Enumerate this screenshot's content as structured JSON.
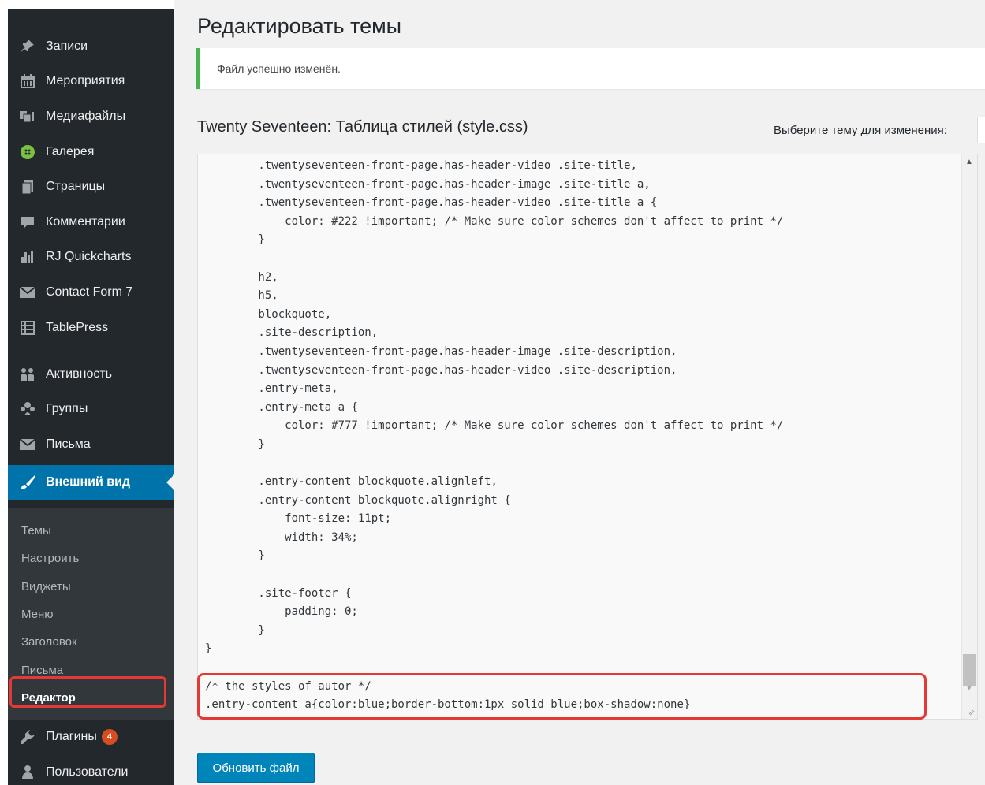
{
  "sidebar": {
    "items": [
      {
        "label": "Записи",
        "icon": "pin-icon"
      },
      {
        "label": "Мероприятия",
        "icon": "calendar-icon"
      },
      {
        "label": "Медиафайлы",
        "icon": "media-icon"
      },
      {
        "label": "Галерея",
        "icon": "gallery-icon"
      },
      {
        "label": "Страницы",
        "icon": "pages-icon"
      },
      {
        "label": "Комментарии",
        "icon": "comment-icon"
      },
      {
        "label": "RJ Quickcharts",
        "icon": "chart-icon"
      },
      {
        "label": "Contact Form 7",
        "icon": "mail-icon"
      },
      {
        "label": "TablePress",
        "icon": "table-icon"
      },
      {
        "label": "Активность",
        "icon": "activity-icon"
      },
      {
        "label": "Группы",
        "icon": "groups-icon"
      },
      {
        "label": "Письма",
        "icon": "envelope-icon"
      },
      {
        "label": "Внешний вид",
        "icon": "brush-icon"
      },
      {
        "label": "Плагины",
        "icon": "plugin-icon",
        "badge": "4"
      },
      {
        "label": "Пользователи",
        "icon": "user-icon"
      }
    ],
    "submenu": [
      "Темы",
      "Настроить",
      "Виджеты",
      "Меню",
      "Заголовок",
      "Письма",
      "Редактор"
    ]
  },
  "page": {
    "title": "Редактировать темы",
    "notice": "Файл успешно изменён.",
    "file_heading": "Twenty Seventeen: Таблица стилей (style.css)",
    "select_label": "Выберите тему для изменения:",
    "update_button": "Обновить файл"
  },
  "editor": {
    "lines": [
      "\t\t.twentyseventeen-front-page.has-header-video .site-title,",
      "\t\t.twentyseventeen-front-page.has-header-image .site-title a,",
      "\t\t.twentyseventeen-front-page.has-header-video .site-title a {",
      "\t\t\tcolor: #222 !important; /* Make sure color schemes don't affect to print */",
      "\t\t}",
      "",
      "\t\th2,",
      "\t\th5,",
      "\t\tblockquote,",
      "\t\t.site-description,",
      "\t\t.twentyseventeen-front-page.has-header-image .site-description,",
      "\t\t.twentyseventeen-front-page.has-header-video .site-description,",
      "\t\t.entry-meta,",
      "\t\t.entry-meta a {",
      "\t\t\tcolor: #777 !important; /* Make sure color schemes don't affect to print */",
      "\t\t}",
      "",
      "\t\t.entry-content blockquote.alignleft,",
      "\t\t.entry-content blockquote.alignright {",
      "\t\t\tfont-size: 11pt;",
      "\t\t\twidth: 34%;",
      "\t\t}",
      "",
      "\t\t.site-footer {",
      "\t\t\tpadding: 0;",
      "\t\t}",
      "}",
      "",
      "/* the styles of autor */",
      ".entry-content a{color:blue;border-bottom:1px solid blue;box-shadow:none}"
    ]
  },
  "colors": {
    "sidebar_bg": "#23282d",
    "submenu_bg": "#32373c",
    "active_bg": "#0073aa",
    "notice_border": "#46b450",
    "highlight": "#e53935",
    "button_bg": "#0085ba",
    "badge_bg": "#d54e21"
  }
}
